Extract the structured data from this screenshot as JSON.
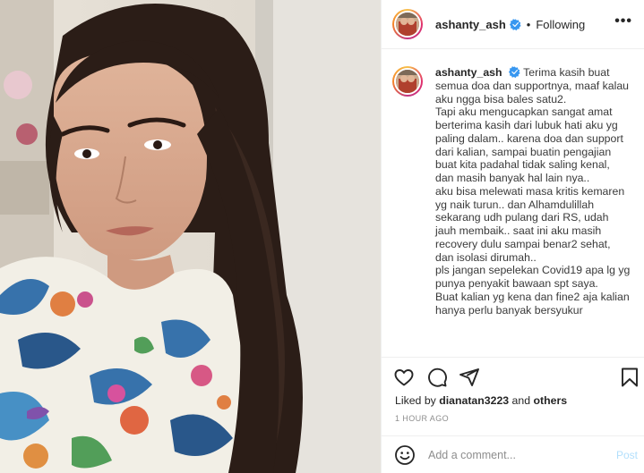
{
  "post": {
    "username": "ashanty_ash",
    "verified": true,
    "separator": "•",
    "follow_state": "Following",
    "more_icon": "more-options-icon",
    "caption_username": "ashanty_ash",
    "caption_text": "Terima kasih buat\nsemua doa dan supportnya, maaf kalau aku ngga bisa bales satu2.\nTapi aku mengucapkan sangat amat berterima kasih dari lubuk hati aku yg paling dalam.. karena doa dan support dari kalian, sampai buatin pengajian buat kita padahal tidak saling kenal, dan masih banyak hal lain nya..\naku bisa melewati masa kritis kemaren yg naik turun.. dan Alhamdulillah sekarang udh pulang dari RS, udah jauh membaik.. saat ini aku masih recovery dulu sampai benar2 sehat, dan isolasi dirumah..\npls jangan sepelekan Covid19 apa lg yg punya penyakit bawaan spt saya.\nBuat kalian yg kena dan fine2 aja kalian hanya perlu banyak bersyukur",
    "likes_prefix": "Liked by ",
    "likes_user": "dianatan3223",
    "likes_middle": " and ",
    "likes_others": "others",
    "time": "1 HOUR AGO"
  },
  "actions": {
    "icons": [
      "heart-icon",
      "comment-icon",
      "share-icon",
      "bookmark-icon"
    ]
  },
  "comment_box": {
    "placeholder": "Add a comment...",
    "post_label": "Post"
  },
  "colors": {
    "verified_blue": "#3897f0",
    "post_disabled": "#b2dffc",
    "muted": "#8e8e8e"
  }
}
